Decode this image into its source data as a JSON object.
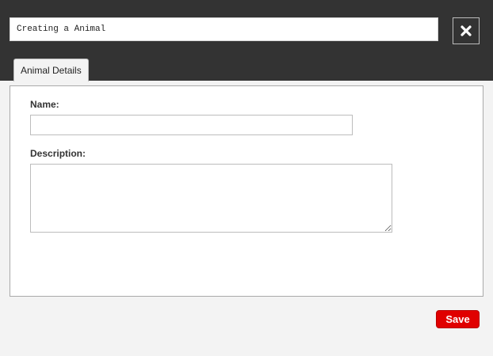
{
  "header": {
    "title_value": "Creating a Animal",
    "close_icon": "close-x-icon"
  },
  "tabs": [
    {
      "label": "Animal Details",
      "active": true
    }
  ],
  "form": {
    "name_label": "Name:",
    "name_value": "",
    "description_label": "Description:",
    "description_value": ""
  },
  "footer": {
    "save_label": "Save"
  },
  "colors": {
    "header_bg": "#333333",
    "body_bg": "#f3f3f3",
    "save_bg": "#e00000"
  }
}
